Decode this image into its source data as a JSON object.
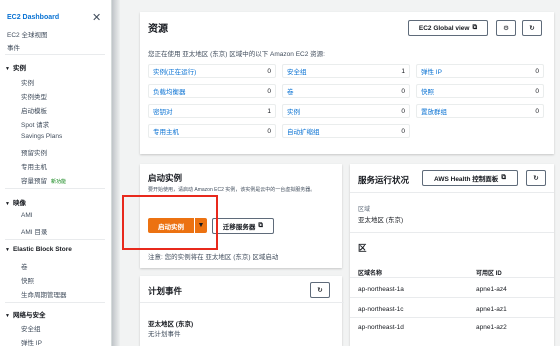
{
  "sidebar": {
    "header": "EC2 Dashboard",
    "links": [
      "EC2 全球视图",
      "事件"
    ],
    "sections": [
      {
        "title": "实例",
        "items": [
          "实例",
          "实例类型",
          "启动模板",
          "Spot 请求",
          "Savings Plans",
          "预留实例",
          "专用主机",
          "容量预留"
        ]
      },
      {
        "title": "映像",
        "items": [
          "AMI",
          "AMI 目录"
        ]
      },
      {
        "title": "Elastic Block Store",
        "items": [
          "卷",
          "快照",
          "生命周期管理器"
        ]
      },
      {
        "title": "网络与安全",
        "items": [
          "安全组",
          "弹性 IP"
        ]
      }
    ],
    "new_badge": "新功能"
  },
  "resources": {
    "title": "资源",
    "global_view_button": "EC2 Global view",
    "description": "您正在使用 亚太地区 (东京) 区域中的以下 Amazon EC2 资源:",
    "cells": [
      {
        "label": "实例(正在运行)",
        "count": "0"
      },
      {
        "label": "安全组",
        "count": "1"
      },
      {
        "label": "弹性 IP",
        "count": "0"
      },
      {
        "label": "负载均衡器",
        "count": "0"
      },
      {
        "label": "卷",
        "count": "0"
      },
      {
        "label": "快照",
        "count": "0"
      },
      {
        "label": "密钥对",
        "count": "1"
      },
      {
        "label": "实例",
        "count": "0"
      },
      {
        "label": "置放群组",
        "count": "0"
      },
      {
        "label": "专用主机",
        "count": "0"
      },
      {
        "label": "自动扩缩组",
        "count": "0"
      }
    ]
  },
  "launch": {
    "title": "启动实例",
    "description": "要开始使用，请启动 Amazon EC2 实例，该实例是云中的一台虚拟服务器。",
    "launch_button": "启动实例",
    "migrate_button": "迁移服务器",
    "note": "注意: 您的实例将在 亚太地区 (东京) 区域启动"
  },
  "events": {
    "title": "计划事件",
    "region": "亚太地区 (东京)",
    "none": "无计划事件"
  },
  "health": {
    "title": "服务运行状况",
    "aws_health_button": "AWS Health 控制面板",
    "region_label": "区域",
    "region_value": "亚太地区 (东京)",
    "zones_heading": "区",
    "col_zone": "区域名称",
    "col_id": "可用区 ID",
    "zones": [
      {
        "name": "ap-northeast-1a",
        "id": "apne1-az4"
      },
      {
        "name": "ap-northeast-1c",
        "id": "apne1-az1"
      },
      {
        "name": "ap-northeast-1d",
        "id": "apne1-az2"
      }
    ]
  },
  "colors": {
    "accent": "#0972d3",
    "primary_button": "#ec7211",
    "highlight_box": "#e8291c"
  }
}
